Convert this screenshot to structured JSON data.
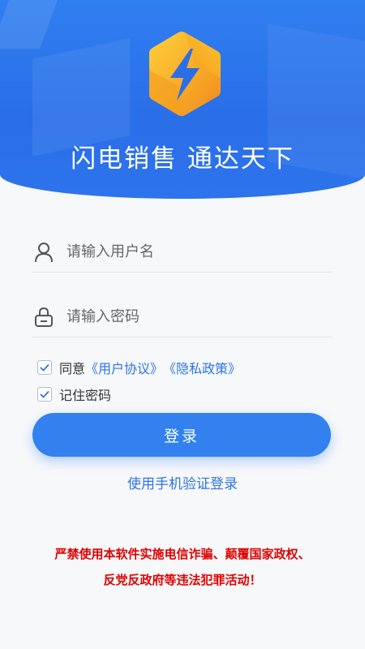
{
  "header": {
    "slogan": "闪电销售 通达天下",
    "logo_icon": "lightning-bolt-icon",
    "colors": {
      "background": "#2a6ee8",
      "logo_gold": "#f6b51d",
      "logo_orange": "#f08a1c"
    }
  },
  "form": {
    "username": {
      "placeholder": "请输入用户名",
      "value": "",
      "icon": "user-icon"
    },
    "password": {
      "placeholder": "请输入密码",
      "value": "",
      "icon": "lock-icon"
    },
    "agree": {
      "checked": true,
      "prefix": "同意",
      "user_agreement": "《用户协议》",
      "privacy_policy": "《隐私政策》"
    },
    "remember": {
      "checked": true,
      "label": "记住密码"
    },
    "login_button": "登录",
    "sms_login_link": "使用手机验证登录"
  },
  "warning": {
    "line1": "严禁使用本软件实施电信诈骗、颠覆国家政权、",
    "line2": "反党反政府等违法犯罪活动！"
  },
  "colors": {
    "accent": "#3281ee",
    "link": "#2d74e6",
    "warning": "#e00000"
  }
}
